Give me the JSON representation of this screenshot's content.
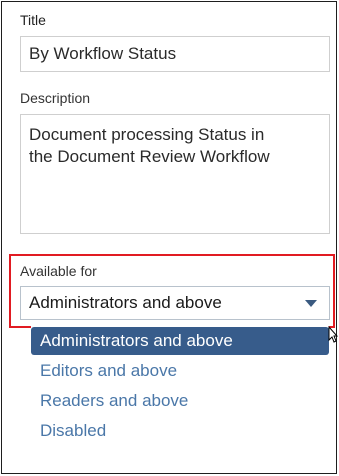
{
  "form": {
    "title_label": "Title",
    "title_value": "By Workflow Status",
    "description_label": "Description",
    "description_value": "Document processing Status in\nthe Document Review Workflow",
    "available_for_label": "Available for",
    "available_for_selected": "Administrators and above"
  },
  "dropdown": {
    "options": [
      "Administrators and above",
      "Editors and above",
      "Readers and above",
      "Disabled"
    ],
    "selected_index": 0
  },
  "colors": {
    "highlight_border": "#e11b22",
    "selected_option_bg": "#375c8b",
    "option_text": "#4a77a8",
    "arrow": "#3a5a80"
  },
  "icons": {
    "select_arrow": "chevron-down-icon",
    "cursor": "mouse-pointer-icon"
  }
}
